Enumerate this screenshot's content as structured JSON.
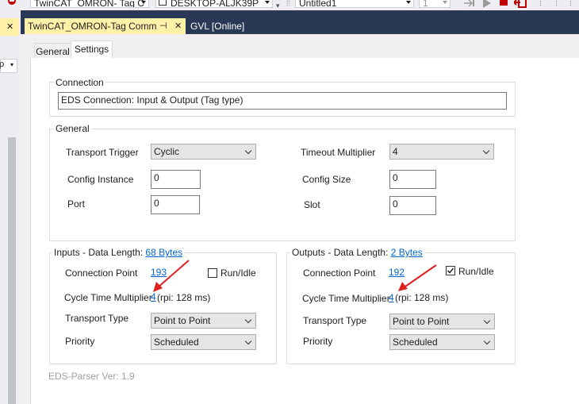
{
  "toolbar": {
    "project_combo": "TwinCAT_OMRON- Tag C",
    "target_combo": "DESKTOP-ALJK39P",
    "solution_combo": "Untitled1",
    "num_combo": "1"
  },
  "doc_tabs": [
    {
      "label": "TwinCAT_OMRON-Tag Comm",
      "pin": "⊣"
    },
    {
      "label": "GVL [Online]"
    }
  ],
  "left_strip": {
    "close": "✕"
  },
  "property_tabs": [
    "General",
    "Settings"
  ],
  "connection": {
    "legend": "Connection",
    "value": "EDS Connection: Input & Output (Tag type)"
  },
  "general": {
    "legend": "General",
    "transport_trigger_label": "Transport Trigger",
    "transport_trigger_value": "Cyclic",
    "timeout_multiplier_label": "Timeout Multiplier",
    "timeout_multiplier_value": "4",
    "config_instance_label": "Config Instance",
    "config_instance_value": "0",
    "config_size_label": "Config Size",
    "config_size_value": "0",
    "port_label": "Port",
    "port_value": "0",
    "slot_label": "Slot",
    "slot_value": "0"
  },
  "inputs": {
    "legend_prefix": "Inputs - Data Length:",
    "legend_link": "68 Bytes",
    "connection_point_label": "Connection Point",
    "connection_point_value": "193",
    "run_idle_label": "Run/Idle",
    "run_idle_checked": false,
    "cycle_time_label": "Cycle Time Multiplier",
    "cycle_time_value": "4",
    "rpi_text": "(rpi: 128 ms)",
    "transport_type_label": "Transport Type",
    "transport_type_value": "Point to Point",
    "priority_label": "Priority",
    "priority_value": "Scheduled"
  },
  "outputs": {
    "legend_prefix": "Outputs - Data Length:",
    "legend_link": "2 Bytes",
    "connection_point_label": "Connection Point",
    "connection_point_value": "192",
    "run_idle_label": "Run/Idle",
    "run_idle_checked": true,
    "cycle_time_label": "Cycle Time Multiplier",
    "cycle_time_value": "4",
    "rpi_text": "(rpi: 128 ms)",
    "transport_type_label": "Transport Type",
    "transport_type_value": "Point to Point",
    "priority_label": "Priority",
    "priority_value": "Scheduled"
  },
  "footer": {
    "parser_version": "EDS-Parser Ver: 1.9"
  },
  "colors": {
    "accent_dark": "#293955",
    "tab_active": "#fff1a8",
    "link": "#0066cc",
    "annotation_arrow": "#e02020"
  }
}
